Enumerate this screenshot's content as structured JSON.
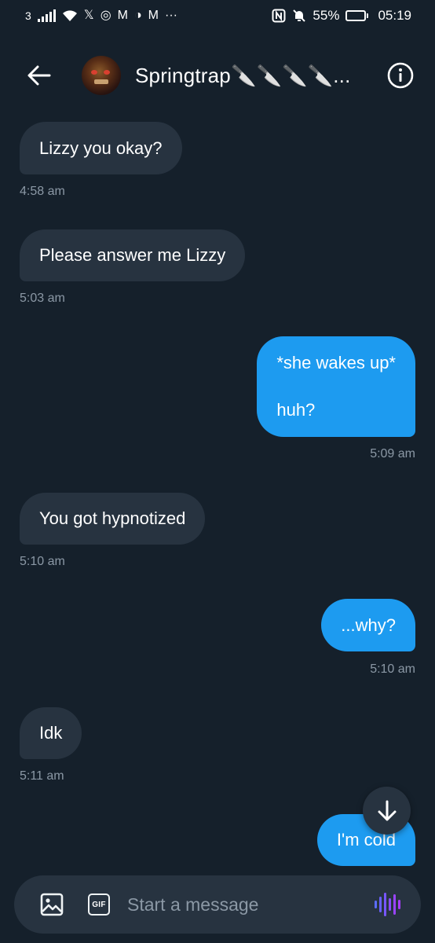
{
  "status_bar": {
    "sim": "3",
    "app_icons": [
      "𝕏",
      "◎",
      "M",
      "◑",
      "M",
      "···"
    ],
    "battery": "55%",
    "battery_level": 0.55,
    "time": "05:19"
  },
  "header": {
    "contact_name": "Springtrap🔪🔪🔪🔪..."
  },
  "messages": [
    {
      "direction": "in",
      "text": "Lizzy you okay?",
      "time": "4:58 am"
    },
    {
      "direction": "in",
      "text": "Please answer me Lizzy",
      "time": "5:03 am"
    },
    {
      "direction": "out",
      "lines": [
        "*she wakes up*",
        "huh?"
      ],
      "time": "5:09 am"
    },
    {
      "direction": "in",
      "text": "You got hypnotized",
      "time": "5:10 am"
    },
    {
      "direction": "out",
      "text": "...why?",
      "time": "5:10 am"
    },
    {
      "direction": "in",
      "text": "Idk",
      "time": "5:11 am"
    },
    {
      "direction": "out",
      "text": "I'm cold",
      "time": ""
    }
  ],
  "composer": {
    "gif_label": "GIF",
    "placeholder": "Start a message"
  },
  "colors": {
    "background": "#15202b",
    "incoming_bubble": "#273340",
    "outgoing_bubble": "#1d9bf0",
    "timestamp": "#8b98a5",
    "voice_accent": "#7856ff"
  },
  "icons": {
    "back": "arrow-left-icon",
    "info": "info-icon",
    "media": "image-icon",
    "gif": "gif-icon",
    "voice": "voice-wave-icon",
    "scroll": "arrow-down-icon"
  }
}
